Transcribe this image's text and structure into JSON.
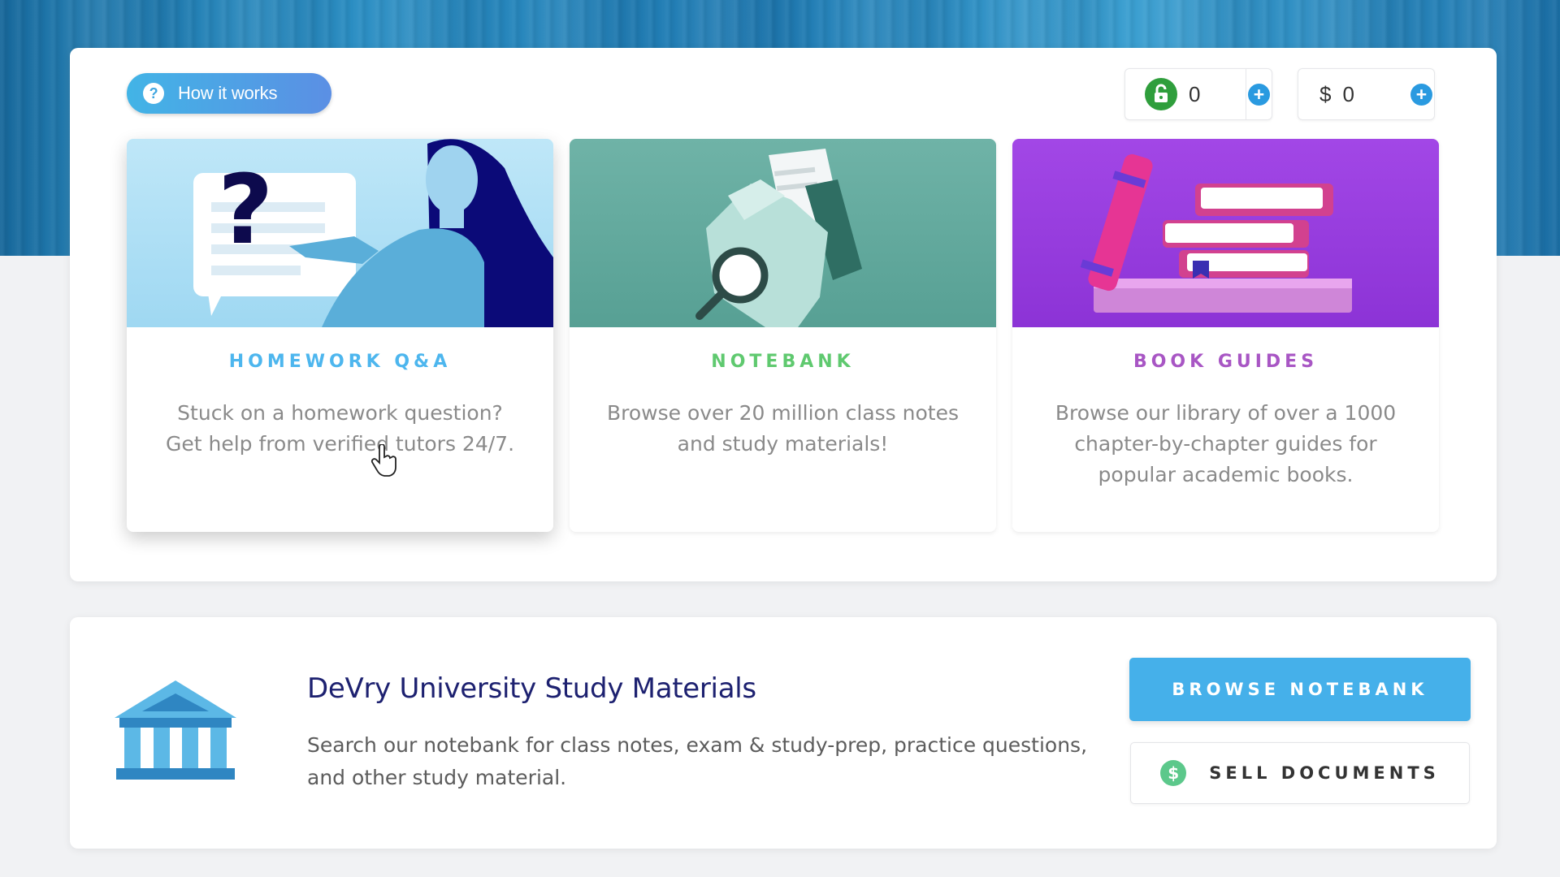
{
  "header": {
    "how_it_works_label": "How it works",
    "unlocks_count": "0",
    "cash_symbol": "$",
    "cash_amount": "0"
  },
  "cards": [
    {
      "title": "HOMEWORK Q&A",
      "description": "Stuck on a homework question? Get help from verified tutors 24/7.",
      "title_color": "#4db6ee",
      "image_color": "#a9ddf5"
    },
    {
      "title": "NOTEBANK",
      "description": "Browse over 20 million class notes and study materials!",
      "title_color": "#5fc96f",
      "image_color": "#5fa79a"
    },
    {
      "title": "BOOK GUIDES",
      "description": "Browse our library of over a 1000 chapter-by-chapter guides for popular academic books.",
      "title_color": "#a856c4",
      "image_color": "#9b3ce2"
    }
  ],
  "university": {
    "title": "DeVry University Study Materials",
    "description": "Search our notebank for class notes, exam & study-prep, practice questions, and other study material.",
    "icon": "institution-icon"
  },
  "actions": {
    "browse_label": "BROWSE NOTEBANK",
    "sell_label": "SELL DOCUMENTS"
  },
  "colors": {
    "accent": "#45b0ea",
    "university_title": "#1d2170",
    "unlock_green": "#2f9e3c",
    "plus_blue": "#2a9ae0"
  },
  "icons": [
    "question-icon",
    "unlock-icon",
    "plus-icon",
    "institution-icon",
    "dollar-icon",
    "hand-cursor-icon"
  ]
}
